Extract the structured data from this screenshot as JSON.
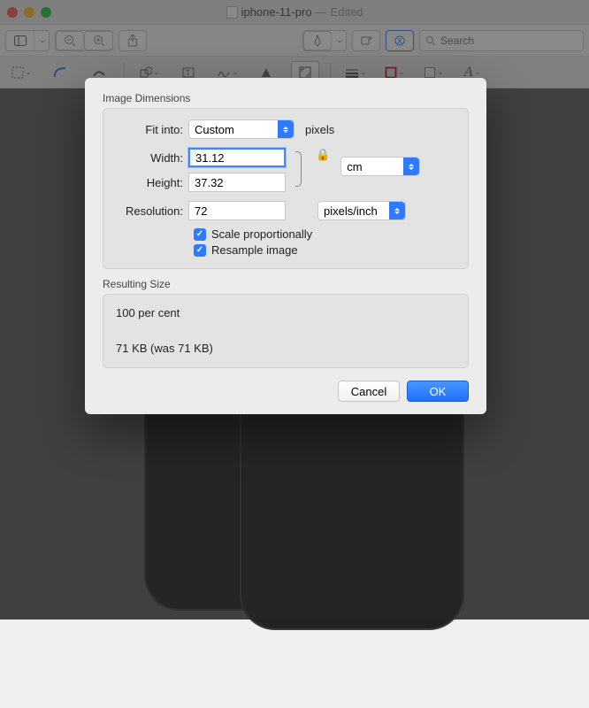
{
  "title": {
    "filename": "iphone-11-pro",
    "status": "Edited"
  },
  "search": {
    "placeholder": "Search"
  },
  "dialog": {
    "section_dimensions": "Image Dimensions",
    "fit_into_label": "Fit into:",
    "fit_into_value": "Custom",
    "fit_into_unit": "pixels",
    "width_label": "Width:",
    "width_value": "31.12",
    "height_label": "Height:",
    "height_value": "37.32",
    "size_unit": "cm",
    "resolution_label": "Resolution:",
    "resolution_value": "72",
    "resolution_unit": "pixels/inch",
    "scale_proportionally": "Scale proportionally",
    "resample_image": "Resample image",
    "section_result": "Resulting Size",
    "result_percent": "100 per cent",
    "result_size": "71 KB (was 71 KB)",
    "cancel": "Cancel",
    "ok": "OK"
  }
}
